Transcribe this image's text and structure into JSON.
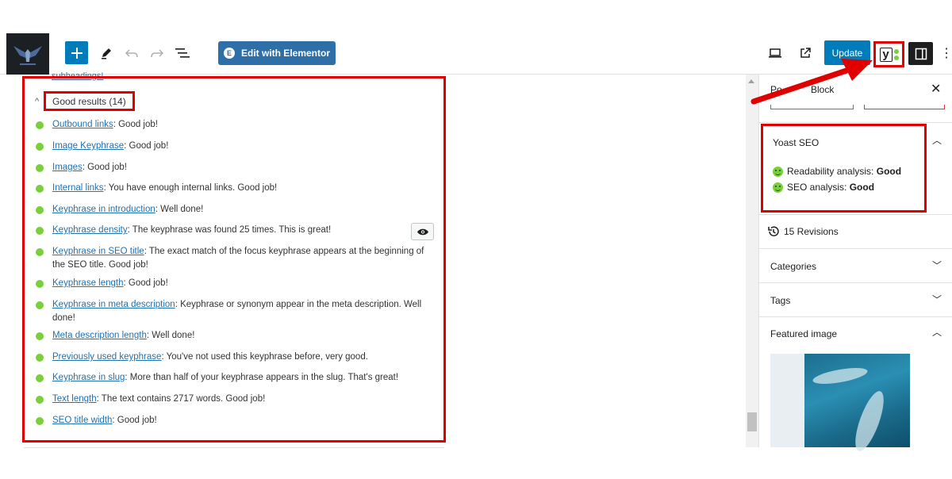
{
  "toolbar": {
    "add_icon": "plus-icon",
    "edit_icon": "pencil-icon",
    "undo_icon": "undo-icon",
    "redo_icon": "redo-icon",
    "list_view_icon": "list-view-icon",
    "elementor_label": "Edit with Elementor",
    "elementor_icon_glyph": "E",
    "update_label": "Update",
    "more_glyph": "⋮",
    "accent_color": "#007cba"
  },
  "left": {
    "cut_off_text": "subheadings!",
    "good_results_label": "Good results (14)",
    "results": [
      {
        "link": "Outbound links",
        "text": ": Good job!"
      },
      {
        "link": "Image Keyphrase",
        "text": ": Good job!"
      },
      {
        "link": "Images",
        "text": ": Good job!"
      },
      {
        "link": "Internal links",
        "text": ": You have enough internal links. Good job!"
      },
      {
        "link": "Keyphrase in introduction",
        "text": ": Well done!"
      },
      {
        "link": "Keyphrase density",
        "text": ": The keyphrase was found 25 times. This is great!"
      },
      {
        "link": "Keyphrase in SEO title",
        "text": ": The exact match of the focus keyphrase appears at the beginning of the SEO title. Good job!"
      },
      {
        "link": "Keyphrase length",
        "text": ": Good job!"
      },
      {
        "link": "Keyphrase in meta description",
        "text": ": Keyphrase or synonym appear in the meta description. Well done!"
      },
      {
        "link": "Meta description length",
        "text": ": Well done!"
      },
      {
        "link": "Previously used keyphrase",
        "text": ": You've not used this keyphrase before, very good."
      },
      {
        "link": "Keyphrase in slug",
        "text": ": More than half of your keyphrase appears in the slug. That's great!"
      },
      {
        "link": "Text length",
        "text": ": The text contains 2717 words. Good job!"
      },
      {
        "link": "SEO title width",
        "text": ": Good job!"
      }
    ],
    "good_color": "#7ad03a",
    "highlight_color": "#e00000"
  },
  "sidebar": {
    "tab_post": "Po",
    "tab_block": "Block",
    "close_glyph": "✕",
    "yoast_title": "Yoast SEO",
    "readability_label": "Readability analysis: ",
    "readability_value": "Good",
    "seo_label": "SEO analysis: ",
    "seo_value": "Good",
    "revisions": "15 Revisions",
    "categories": "Categories",
    "tags": "Tags",
    "featured_image": "Featured image"
  }
}
